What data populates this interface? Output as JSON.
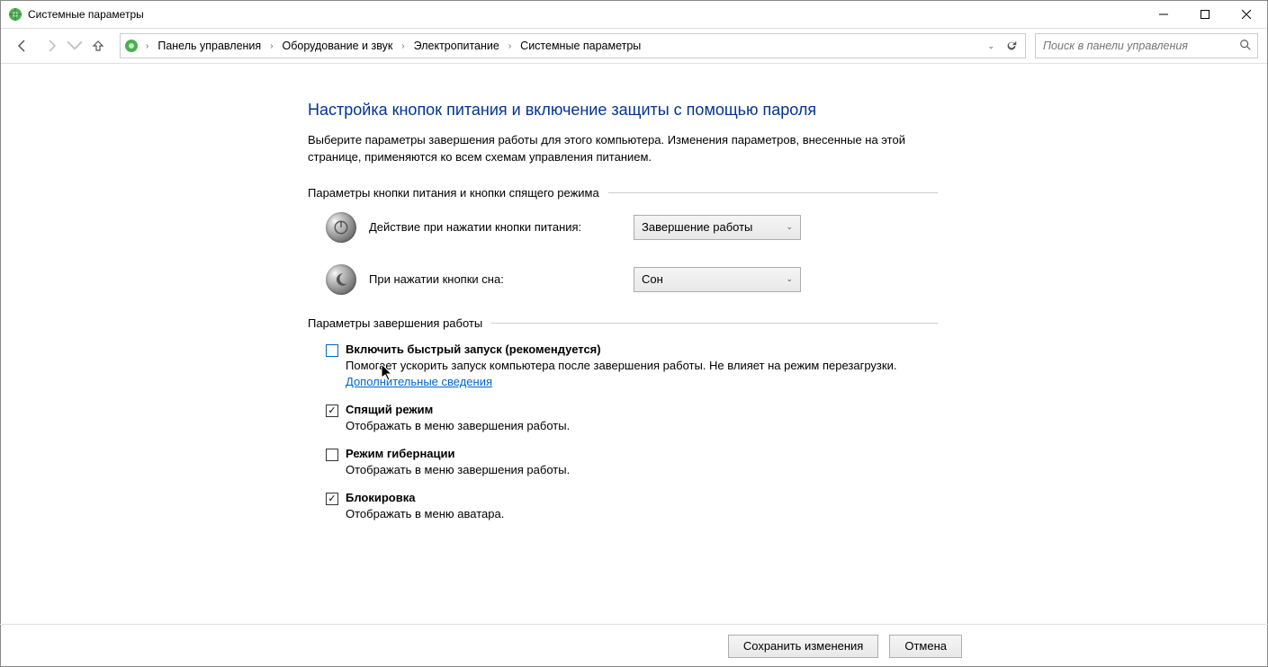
{
  "window": {
    "title": "Системные параметры"
  },
  "breadcrumbs": {
    "items": [
      "Панель управления",
      "Оборудование и звук",
      "Электропитание",
      "Системные параметры"
    ]
  },
  "search": {
    "placeholder": "Поиск в панели управления"
  },
  "page": {
    "title": "Настройка кнопок питания и включение защиты с помощью пароля",
    "description": "Выберите параметры завершения работы для этого компьютера. Изменения параметров, внесенные на этой странице, применяются ко всем схемам управления питанием."
  },
  "section1": {
    "legend": "Параметры кнопки питания и кнопки спящего режима",
    "power_label": "Действие при нажатии кнопки питания:",
    "power_value": "Завершение работы",
    "sleep_label": "При нажатии кнопки сна:",
    "sleep_value": "Сон"
  },
  "section2": {
    "legend": "Параметры завершения работы",
    "fast_start": {
      "title": "Включить быстрый запуск (рекомендуется)",
      "desc_prefix": "Помогает ускорить запуск компьютера после завершения работы. Не влияет на режим перезагрузки. ",
      "link": "Дополнительные сведения"
    },
    "sleep": {
      "title": "Спящий режим",
      "desc": "Отображать в меню завершения работы."
    },
    "hibernate": {
      "title": "Режим гибернации",
      "desc": "Отображать в меню завершения работы."
    },
    "lock": {
      "title": "Блокировка",
      "desc": "Отображать в меню аватара."
    }
  },
  "footer": {
    "save": "Сохранить изменения",
    "cancel": "Отмена"
  }
}
